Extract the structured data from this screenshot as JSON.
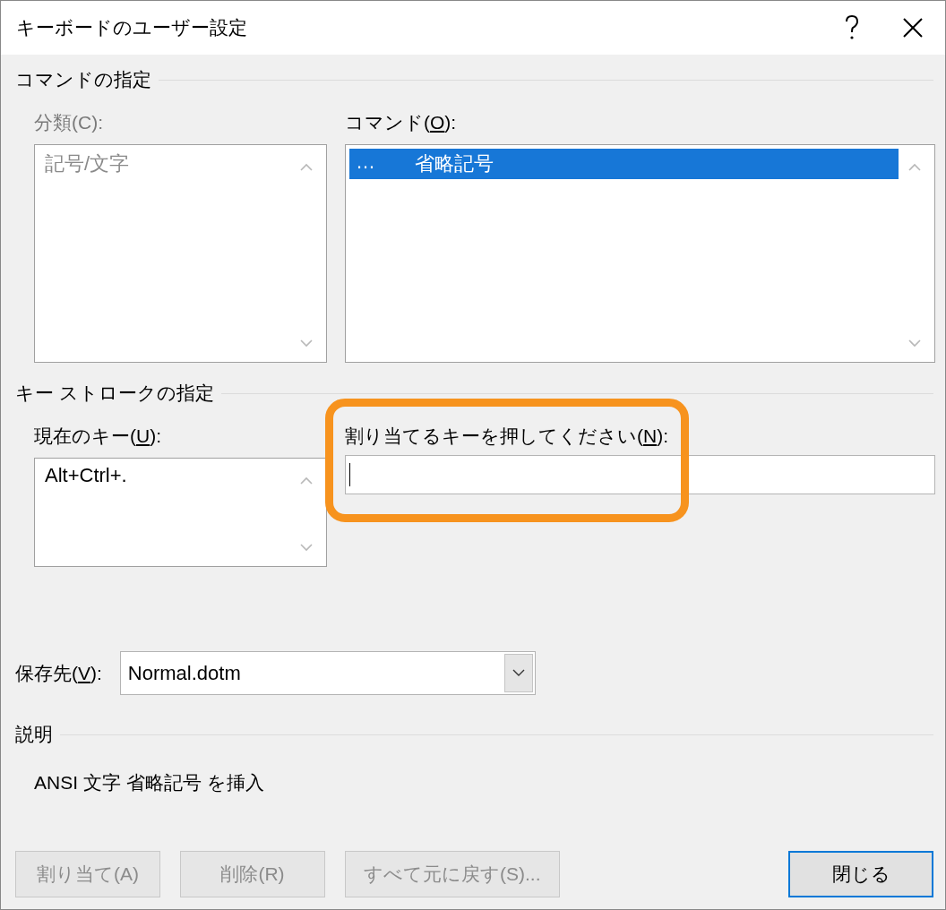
{
  "window": {
    "title": "キーボードのユーザー設定"
  },
  "command_section": {
    "heading": "コマンドの指定",
    "category": {
      "label": {
        "before": "分類(C):"
      },
      "disabled": true,
      "items": [
        {
          "text": "記号/文字",
          "selected": false
        }
      ]
    },
    "command": {
      "label": {
        "before": "コマンド(",
        "key": "O",
        "after": "):"
      },
      "disabled": false,
      "items": [
        {
          "symbol": "…",
          "text": "省略記号",
          "selected": true
        }
      ]
    }
  },
  "keystroke_section": {
    "heading": "キー ストロークの指定",
    "current_keys": {
      "label": {
        "before": "現在のキー(",
        "key": "U",
        "after": "):"
      },
      "items": [
        {
          "text": "Alt+Ctrl+.",
          "selected": false
        }
      ]
    },
    "new_key": {
      "label": {
        "before": "割り当てるキーを押してください(",
        "key": "N",
        "after": "):"
      },
      "focused": true,
      "highlighted": true
    }
  },
  "save_in": {
    "label": {
      "before": "保存先(",
      "key": "V",
      "after": "):"
    },
    "value": "Normal.dotm"
  },
  "description": {
    "heading": "説明",
    "text": "ANSI 文字 省略記号 を挿入"
  },
  "buttons": [
    {
      "label": "割り当て(A)",
      "disabled": true,
      "kind": "action"
    },
    {
      "label": "削除(R)",
      "disabled": true,
      "kind": "action"
    },
    {
      "label": "すべて元に戻す(S)...",
      "disabled": true,
      "kind": "action"
    },
    {
      "label": "閉じる",
      "disabled": false,
      "kind": "close"
    }
  ]
}
